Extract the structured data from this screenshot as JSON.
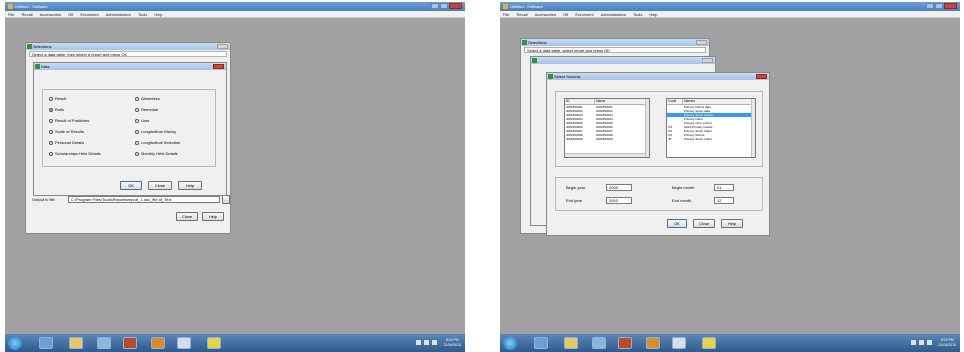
{
  "left": {
    "app_title": "Untitled - Software",
    "menu": [
      "File",
      "Recall",
      "Accessories",
      "Off",
      "Enrolment",
      "Administration",
      "Tools",
      "Help"
    ],
    "back_window": {
      "title": "Selections",
      "strip": "Select a data table, then select a report and press OK",
      "export_label": "Output to file",
      "export_value": "C:\\Program Files\\Tools\\Reports\\report_1.doc_file of_Text",
      "close_button": "Close",
      "help_button": "Help"
    },
    "dialog": {
      "title": "Data",
      "options_left": [
        {
          "label": "Result",
          "selected": false
        },
        {
          "label": "Rolls",
          "selected": true
        },
        {
          "label": "Result of Publishes",
          "selected": false
        },
        {
          "label": "Scale of Results",
          "selected": false
        },
        {
          "label": "Personal Details",
          "selected": false
        },
        {
          "label": "Scholarships Held Details",
          "selected": false
        }
      ],
      "options_right": [
        {
          "label": "Absentees",
          "selected": false
        },
        {
          "label": "Remedial",
          "selected": false
        },
        {
          "label": "Lists",
          "selected": false
        },
        {
          "label": "Longitudinal History",
          "selected": false
        },
        {
          "label": "Longitudinal Selection",
          "selected": false
        },
        {
          "label": "Monthly Held Details",
          "selected": false
        }
      ],
      "ok_button": "OK",
      "close_button": "Close",
      "help_button": "Help"
    },
    "clock": {
      "time": "6:02 PM",
      "date": "21/04/2010"
    }
  },
  "right": {
    "app_title": "Untitled - Software",
    "menu": [
      "File",
      "Recall",
      "Accessories",
      "Off",
      "Enrolment",
      "Administration",
      "Tools",
      "Help"
    ],
    "back_window": {
      "title": "Selections",
      "strip": "Select a data table, select report and press OK"
    },
    "dialog": {
      "title": "Select Schools",
      "left_list": {
        "headers": [
          "ID",
          "Name"
        ],
        "rows": [
          [
            "2001850001",
            "2001850001"
          ],
          [
            "2001850002",
            "2001850002"
          ],
          [
            "2001850003",
            "2001850003"
          ],
          [
            "2001850004",
            "2001850004"
          ],
          [
            "2001850005",
            "2001850005"
          ],
          [
            "2001850006",
            "2001850006"
          ],
          [
            "2001850007",
            "2001850007"
          ],
          [
            "2001850008",
            "2001850008"
          ],
          [
            "2001850009",
            "2001850009"
          ]
        ]
      },
      "right_list": {
        "headers": [
          "Code",
          "Names"
        ],
        "rows": [
          [
            "",
            "Primary Infants data",
            false
          ],
          [
            "",
            "Primary Junior data",
            false
          ],
          [
            "",
            "Primary Junior results",
            true
          ],
          [
            "",
            "Primary Infant",
            false
          ],
          [
            "",
            "Primary other school",
            false
          ],
          [
            "CS",
            "Infant Primary results",
            false
          ],
          [
            "CS",
            "Primary Junior Infant",
            false
          ],
          [
            "CS",
            "Primary School",
            false
          ],
          [
            "JP",
            "Primary Junior Infant",
            false
          ]
        ]
      },
      "begin_year_label": "Begin year",
      "begin_year_value": "2003",
      "end_year_label": "End year",
      "end_year_value": "2010",
      "begin_month_label": "Begin month",
      "begin_month_value": "01",
      "end_month_label": "End month",
      "end_month_value": "12",
      "ok_button": "OK",
      "close_button": "Close",
      "help_button": "Help"
    },
    "clock": {
      "time": "6:02 PM",
      "date": "21/04/2010"
    }
  }
}
